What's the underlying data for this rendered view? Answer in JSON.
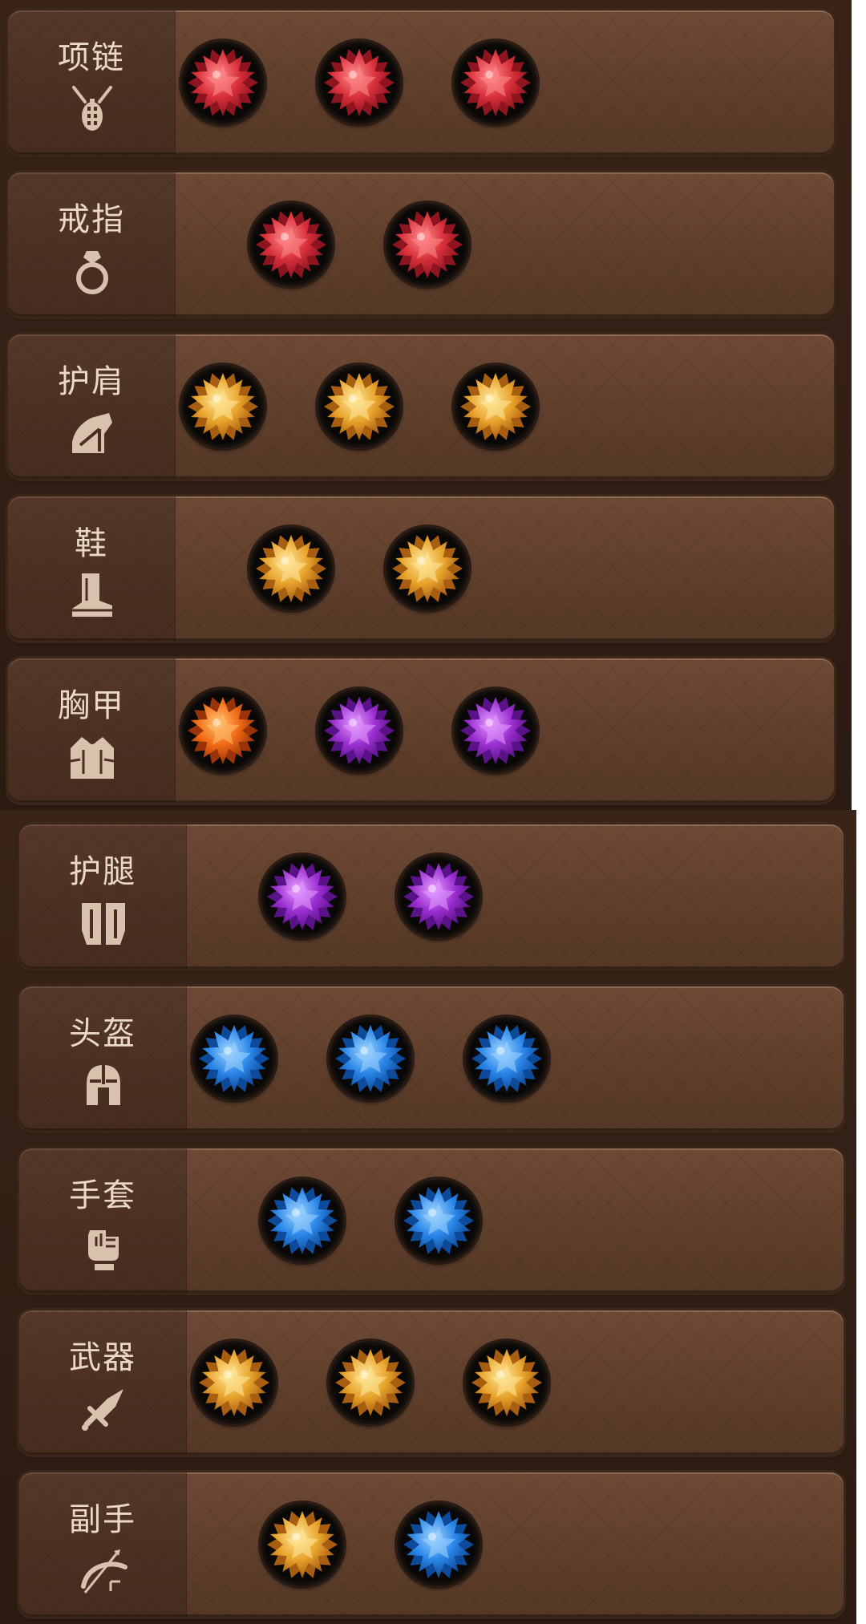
{
  "colors": {
    "red": {
      "base": "#d8303a",
      "light": "#ff8a8a",
      "dark": "#8e1420"
    },
    "gold": {
      "base": "#e8a42c",
      "light": "#ffe79a",
      "dark": "#a85e10"
    },
    "orange": {
      "base": "#f06a14",
      "light": "#ffc070",
      "dark": "#9a3408"
    },
    "purple": {
      "base": "#9a2ed0",
      "light": "#e39aff",
      "dark": "#5a1288"
    },
    "blue": {
      "base": "#2a86e8",
      "light": "#9ed4ff",
      "dark": "#0e4a9a"
    }
  },
  "rows": [
    {
      "label": "项链",
      "icon": "necklace-icon",
      "gems": [
        "red",
        "red",
        "red"
      ]
    },
    {
      "label": "戒指",
      "icon": "ring-icon",
      "gems": [
        "red",
        "red"
      ]
    },
    {
      "label": "护肩",
      "icon": "shoulder-guard-icon",
      "gems": [
        "gold",
        "gold",
        "gold"
      ]
    },
    {
      "label": "鞋",
      "icon": "boots-icon",
      "gems": [
        "gold",
        "gold"
      ]
    },
    {
      "label": "胸甲",
      "icon": "chest-armor-icon",
      "gems": [
        "orange",
        "purple",
        "purple"
      ]
    },
    {
      "label": "护腿",
      "icon": "leg-guard-icon",
      "gems": [
        "purple",
        "purple"
      ]
    },
    {
      "label": "头盔",
      "icon": "helmet-icon",
      "gems": [
        "blue",
        "blue",
        "blue"
      ]
    },
    {
      "label": "手套",
      "icon": "glove-icon",
      "gems": [
        "blue",
        "blue"
      ]
    },
    {
      "label": "武器",
      "icon": "weapon-icon",
      "gems": [
        "gold",
        "gold",
        "gold"
      ]
    },
    {
      "label": "副手",
      "icon": "offhand-bow-icon",
      "gems": [
        "gold",
        "blue"
      ]
    }
  ]
}
